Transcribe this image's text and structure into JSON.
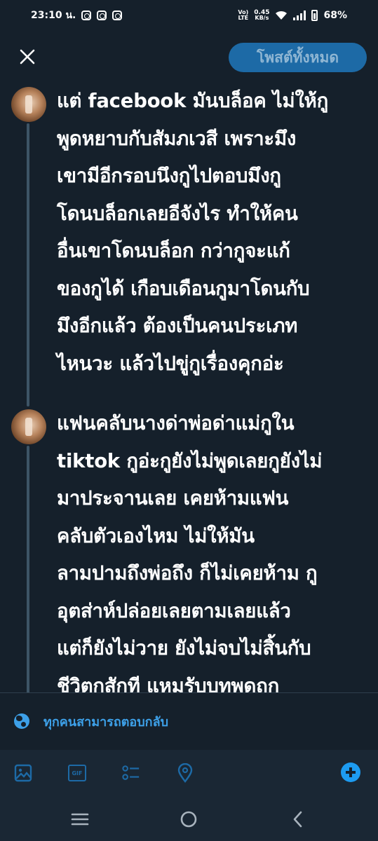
{
  "status_bar": {
    "time": "23:10 น.",
    "network_top": "Vo)",
    "network_bottom": "LTE",
    "speed_top": "0.45",
    "speed_bottom": "KB/s",
    "battery": "68%"
  },
  "header": {
    "close_icon": "close-icon",
    "post_all_label": "โพสต์ทั้งหมด"
  },
  "thread": [
    {
      "text": "แต่ facebook มันบล็อค ไม่ให้กู\nพูดหยาบกับสัมภเวสี เพราะมึง\nเขามีอีกรอบนึงกูไปตอบมึงกู\nโดนบล็อกเลยอีจังไร ทำให้คน\nอื่นเขาโดนบล็อก กว่ากูจะแก้\nของกูได้ เกือบเดือนกูมาโดนกับ\nมึงอีกแล้ว ต้องเป็นคนประเภท\nไหนวะ แล้วไปขู่กูเรื่องคุกอ่ะ"
    },
    {
      "text": "แฟนคลับนางด่าพ่อด่าแม่กูใน\ntiktok กูอ่ะกูยังไม่พูดเลยกูยังไม่\nมาประจานเลย เคยห้ามแฟน\nคลับตัวเองไหม ไม่ให้มัน\nลามปามถึงพ่อถึง ก็ไม่เคยห้าม กู\nอุตส่าห์ปล่อยเลยตามเลยแล้ว\nแต่ก็ยังไม่วาย ยังไม่จบไม่สิ้นกับ\nชีวิตกูสักที แหมรับบทพูดถูก"
    }
  ],
  "reply_setting": {
    "icon": "globe-icon",
    "label": "ทุกคนสามารถตอบกลับ"
  },
  "toolbar": {
    "gif_label": "GIF",
    "icons": [
      "image-icon",
      "gif-icon",
      "poll-icon",
      "location-icon",
      "add-post-icon"
    ],
    "accent": "#1d9bf0"
  },
  "navbar": {
    "icons": [
      "recent-apps-icon",
      "home-icon",
      "back-icon"
    ]
  }
}
